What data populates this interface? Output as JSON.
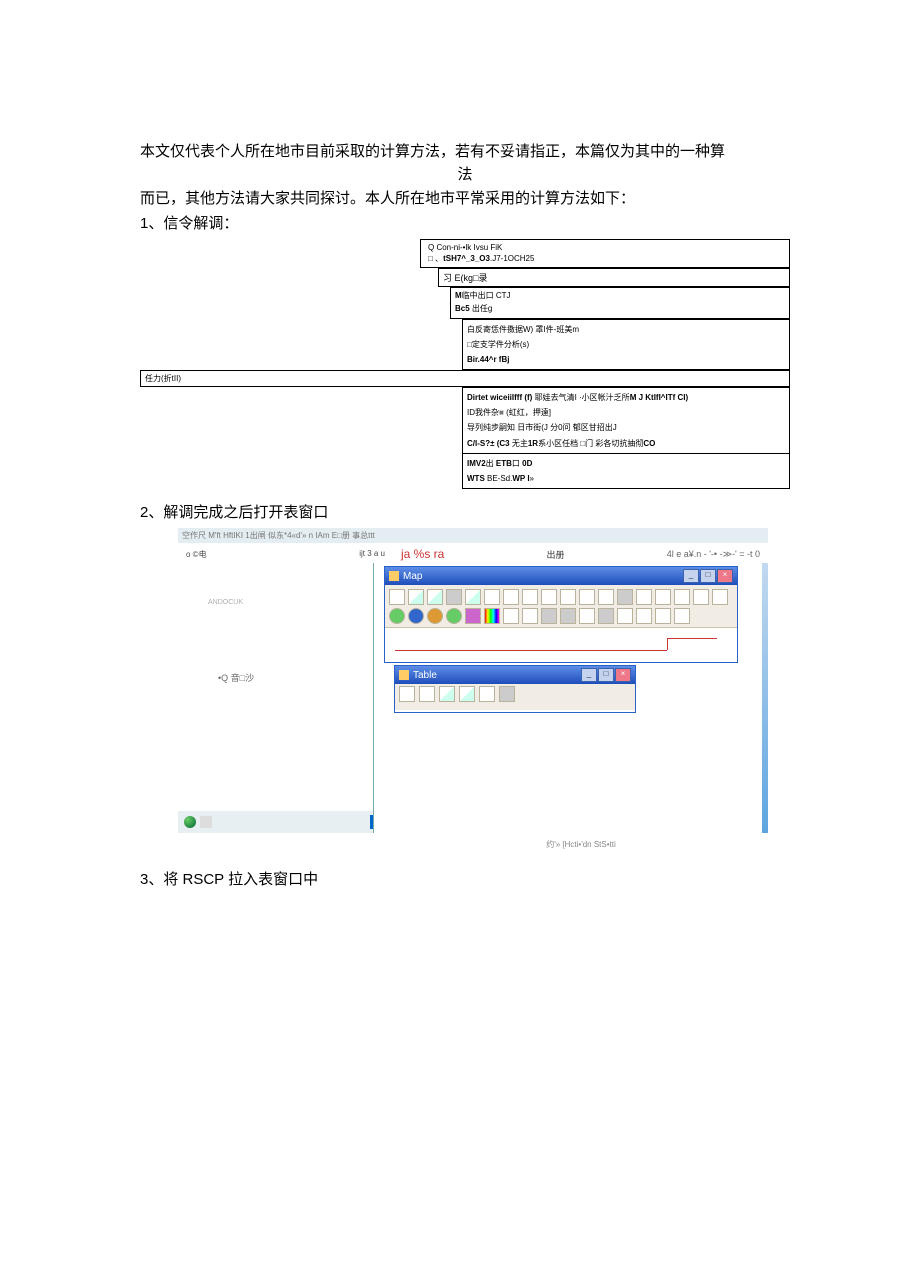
{
  "intro": {
    "line1": "本文仅代表个人所在地市目前采取的计算方法，若有不妥请指正，本篇仅为其中的一种算",
    "line2": "法",
    "line3": "而已，其他方法请大家共同探讨。本人所在地市平常采用的计算方法如下："
  },
  "steps": {
    "s1": "1、信令解调：",
    "s2": "2、解调完成之后打开表窗口",
    "s3": "3、将 RSCP 拉入表窗口中"
  },
  "fig1": {
    "root_l1": "Q  Con-ni-•lk Ivsu FiK",
    "root_l2_pre": "□ 、",
    "root_l2_bold": "tSH7^_3_O3",
    "root_l2_post": ".J7-1OCH25",
    "sub1": "习 E(kg□录",
    "sub2_l1_bold": "M",
    "sub2_l1_rest": "临中出口  CTJ",
    "sub2_l2_bold": "Bc5",
    "sub2_l2_rest": "  出任g",
    "sub3_l1": "白反寄恁件擞据W)  罩I件-班美m",
    "sub3_l2": "□定支学件分析(s)",
    "sub3_l3_bold": "Bir.44^r fBj",
    "wide": "任力(折tII)",
    "sub4_l1_bold": "Dirtet wiceiiIfff (f)",
    "sub4_l1_rest": " 耶娃去气清I ·小区帐汁乏所",
    "sub4_l1_bold2": "M J KtIfI^ITf CI)",
    "sub4_l2_pre": "ID我件杂",
    "sub4_l2_blk": "■",
    "sub4_l2_rest": " (虹红，押遠]",
    "sub4_l3": "导列纯步嗣知 日市街(J 分0问 郁区甘招出J",
    "sub4_l4_bold": "C/l-S?±  (C3",
    "sub4_l4_rest": " 无主",
    "sub4_l4_bold2": "1R",
    "sub4_l4_rest2": "系小区任档 □门 彩各切抗抽彻",
    "sub4_l4_bold3": "CO",
    "sub4_l5_bold": "IMV2",
    "sub4_l5_rest": "出 ",
    "sub4_l5_bold2": "ETB",
    "sub4_l5_mid": "口  ",
    "sub4_l5_bold3": "0D",
    "sub4_l6_bold": "WTS",
    "sub4_l6_mid": " BE-Sd.",
    "sub4_l6_bold2": "WP I",
    "sub4_l6_end": "»"
  },
  "fig2": {
    "titlebar": "空作尺   M'ft HftIKI 1出闸  似东*4«d'» n  IAm E□册  事总ttt",
    "left_a": "o  ©电",
    "left_b": "ijt 3 a u",
    "red": "ja  %s ra",
    "hdr_mid": "出册",
    "hdr_date": "4l  e  a¥.n  - '-• -≫-' = -t 0",
    "side1": "ANDOCUK",
    "side2": "•Q 音□沙",
    "map_title": "Map",
    "table_title": "Table",
    "footer": "约'»   [Hcti•'dn StS•tti"
  }
}
